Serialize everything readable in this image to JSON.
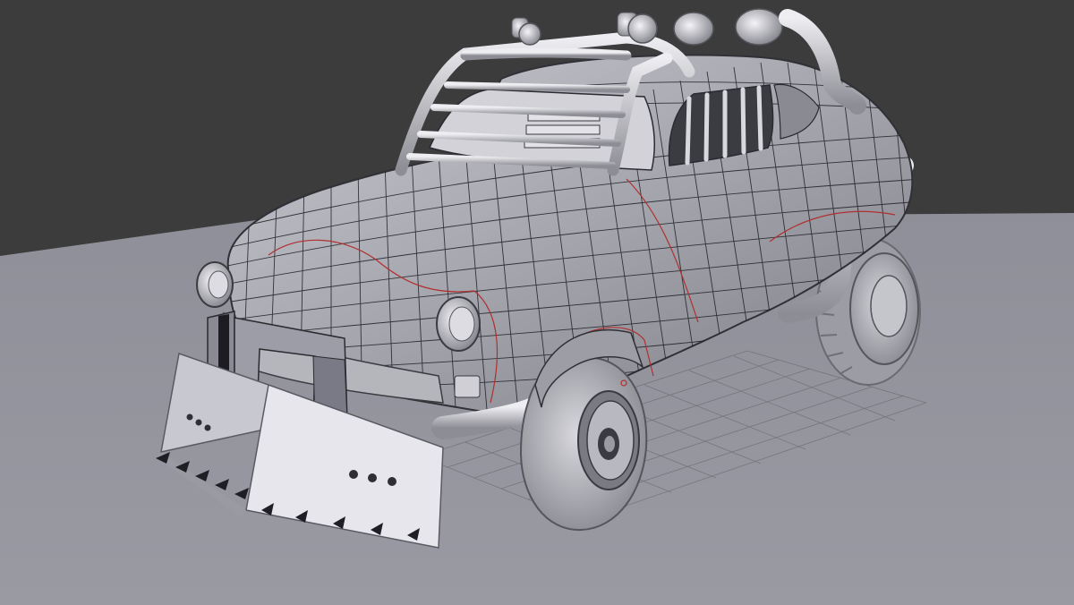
{
  "viewport": {
    "background_color": "#3c3c3c",
    "floor_color": "#8e8e98",
    "model_color": "#a6a6ae",
    "wire_color": "#1e1e24",
    "seam_color": "#b03030",
    "grid_color": "#707078"
  }
}
